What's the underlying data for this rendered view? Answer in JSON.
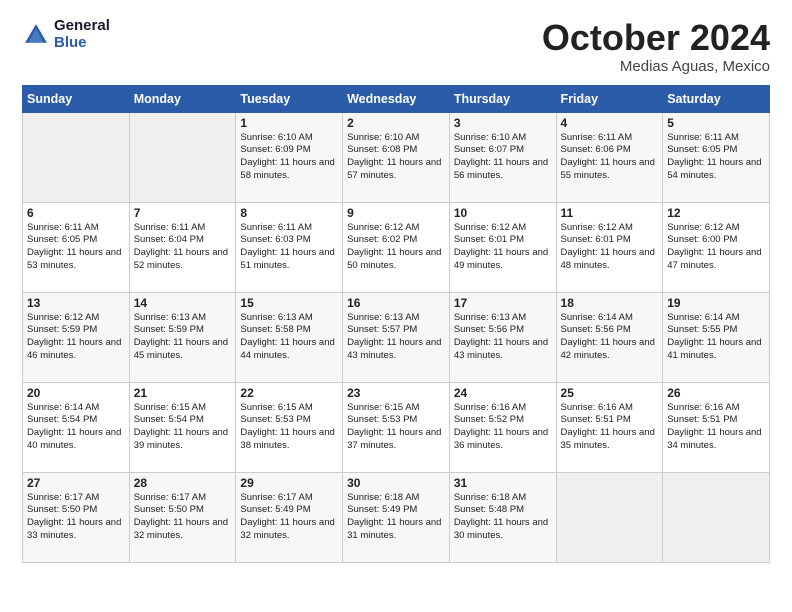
{
  "header": {
    "logo_general": "General",
    "logo_blue": "Blue",
    "month": "October 2024",
    "location": "Medias Aguas, Mexico"
  },
  "weekdays": [
    "Sunday",
    "Monday",
    "Tuesday",
    "Wednesday",
    "Thursday",
    "Friday",
    "Saturday"
  ],
  "weeks": [
    [
      {
        "day": "",
        "info": ""
      },
      {
        "day": "",
        "info": ""
      },
      {
        "day": "1",
        "info": "Sunrise: 6:10 AM\nSunset: 6:09 PM\nDaylight: 11 hours and 58 minutes."
      },
      {
        "day": "2",
        "info": "Sunrise: 6:10 AM\nSunset: 6:08 PM\nDaylight: 11 hours and 57 minutes."
      },
      {
        "day": "3",
        "info": "Sunrise: 6:10 AM\nSunset: 6:07 PM\nDaylight: 11 hours and 56 minutes."
      },
      {
        "day": "4",
        "info": "Sunrise: 6:11 AM\nSunset: 6:06 PM\nDaylight: 11 hours and 55 minutes."
      },
      {
        "day": "5",
        "info": "Sunrise: 6:11 AM\nSunset: 6:05 PM\nDaylight: 11 hours and 54 minutes."
      }
    ],
    [
      {
        "day": "6",
        "info": "Sunrise: 6:11 AM\nSunset: 6:05 PM\nDaylight: 11 hours and 53 minutes."
      },
      {
        "day": "7",
        "info": "Sunrise: 6:11 AM\nSunset: 6:04 PM\nDaylight: 11 hours and 52 minutes."
      },
      {
        "day": "8",
        "info": "Sunrise: 6:11 AM\nSunset: 6:03 PM\nDaylight: 11 hours and 51 minutes."
      },
      {
        "day": "9",
        "info": "Sunrise: 6:12 AM\nSunset: 6:02 PM\nDaylight: 11 hours and 50 minutes."
      },
      {
        "day": "10",
        "info": "Sunrise: 6:12 AM\nSunset: 6:01 PM\nDaylight: 11 hours and 49 minutes."
      },
      {
        "day": "11",
        "info": "Sunrise: 6:12 AM\nSunset: 6:01 PM\nDaylight: 11 hours and 48 minutes."
      },
      {
        "day": "12",
        "info": "Sunrise: 6:12 AM\nSunset: 6:00 PM\nDaylight: 11 hours and 47 minutes."
      }
    ],
    [
      {
        "day": "13",
        "info": "Sunrise: 6:12 AM\nSunset: 5:59 PM\nDaylight: 11 hours and 46 minutes."
      },
      {
        "day": "14",
        "info": "Sunrise: 6:13 AM\nSunset: 5:59 PM\nDaylight: 11 hours and 45 minutes."
      },
      {
        "day": "15",
        "info": "Sunrise: 6:13 AM\nSunset: 5:58 PM\nDaylight: 11 hours and 44 minutes."
      },
      {
        "day": "16",
        "info": "Sunrise: 6:13 AM\nSunset: 5:57 PM\nDaylight: 11 hours and 43 minutes."
      },
      {
        "day": "17",
        "info": "Sunrise: 6:13 AM\nSunset: 5:56 PM\nDaylight: 11 hours and 43 minutes."
      },
      {
        "day": "18",
        "info": "Sunrise: 6:14 AM\nSunset: 5:56 PM\nDaylight: 11 hours and 42 minutes."
      },
      {
        "day": "19",
        "info": "Sunrise: 6:14 AM\nSunset: 5:55 PM\nDaylight: 11 hours and 41 minutes."
      }
    ],
    [
      {
        "day": "20",
        "info": "Sunrise: 6:14 AM\nSunset: 5:54 PM\nDaylight: 11 hours and 40 minutes."
      },
      {
        "day": "21",
        "info": "Sunrise: 6:15 AM\nSunset: 5:54 PM\nDaylight: 11 hours and 39 minutes."
      },
      {
        "day": "22",
        "info": "Sunrise: 6:15 AM\nSunset: 5:53 PM\nDaylight: 11 hours and 38 minutes."
      },
      {
        "day": "23",
        "info": "Sunrise: 6:15 AM\nSunset: 5:53 PM\nDaylight: 11 hours and 37 minutes."
      },
      {
        "day": "24",
        "info": "Sunrise: 6:16 AM\nSunset: 5:52 PM\nDaylight: 11 hours and 36 minutes."
      },
      {
        "day": "25",
        "info": "Sunrise: 6:16 AM\nSunset: 5:51 PM\nDaylight: 11 hours and 35 minutes."
      },
      {
        "day": "26",
        "info": "Sunrise: 6:16 AM\nSunset: 5:51 PM\nDaylight: 11 hours and 34 minutes."
      }
    ],
    [
      {
        "day": "27",
        "info": "Sunrise: 6:17 AM\nSunset: 5:50 PM\nDaylight: 11 hours and 33 minutes."
      },
      {
        "day": "28",
        "info": "Sunrise: 6:17 AM\nSunset: 5:50 PM\nDaylight: 11 hours and 32 minutes."
      },
      {
        "day": "29",
        "info": "Sunrise: 6:17 AM\nSunset: 5:49 PM\nDaylight: 11 hours and 32 minutes."
      },
      {
        "day": "30",
        "info": "Sunrise: 6:18 AM\nSunset: 5:49 PM\nDaylight: 11 hours and 31 minutes."
      },
      {
        "day": "31",
        "info": "Sunrise: 6:18 AM\nSunset: 5:48 PM\nDaylight: 11 hours and 30 minutes."
      },
      {
        "day": "",
        "info": ""
      },
      {
        "day": "",
        "info": ""
      }
    ]
  ]
}
